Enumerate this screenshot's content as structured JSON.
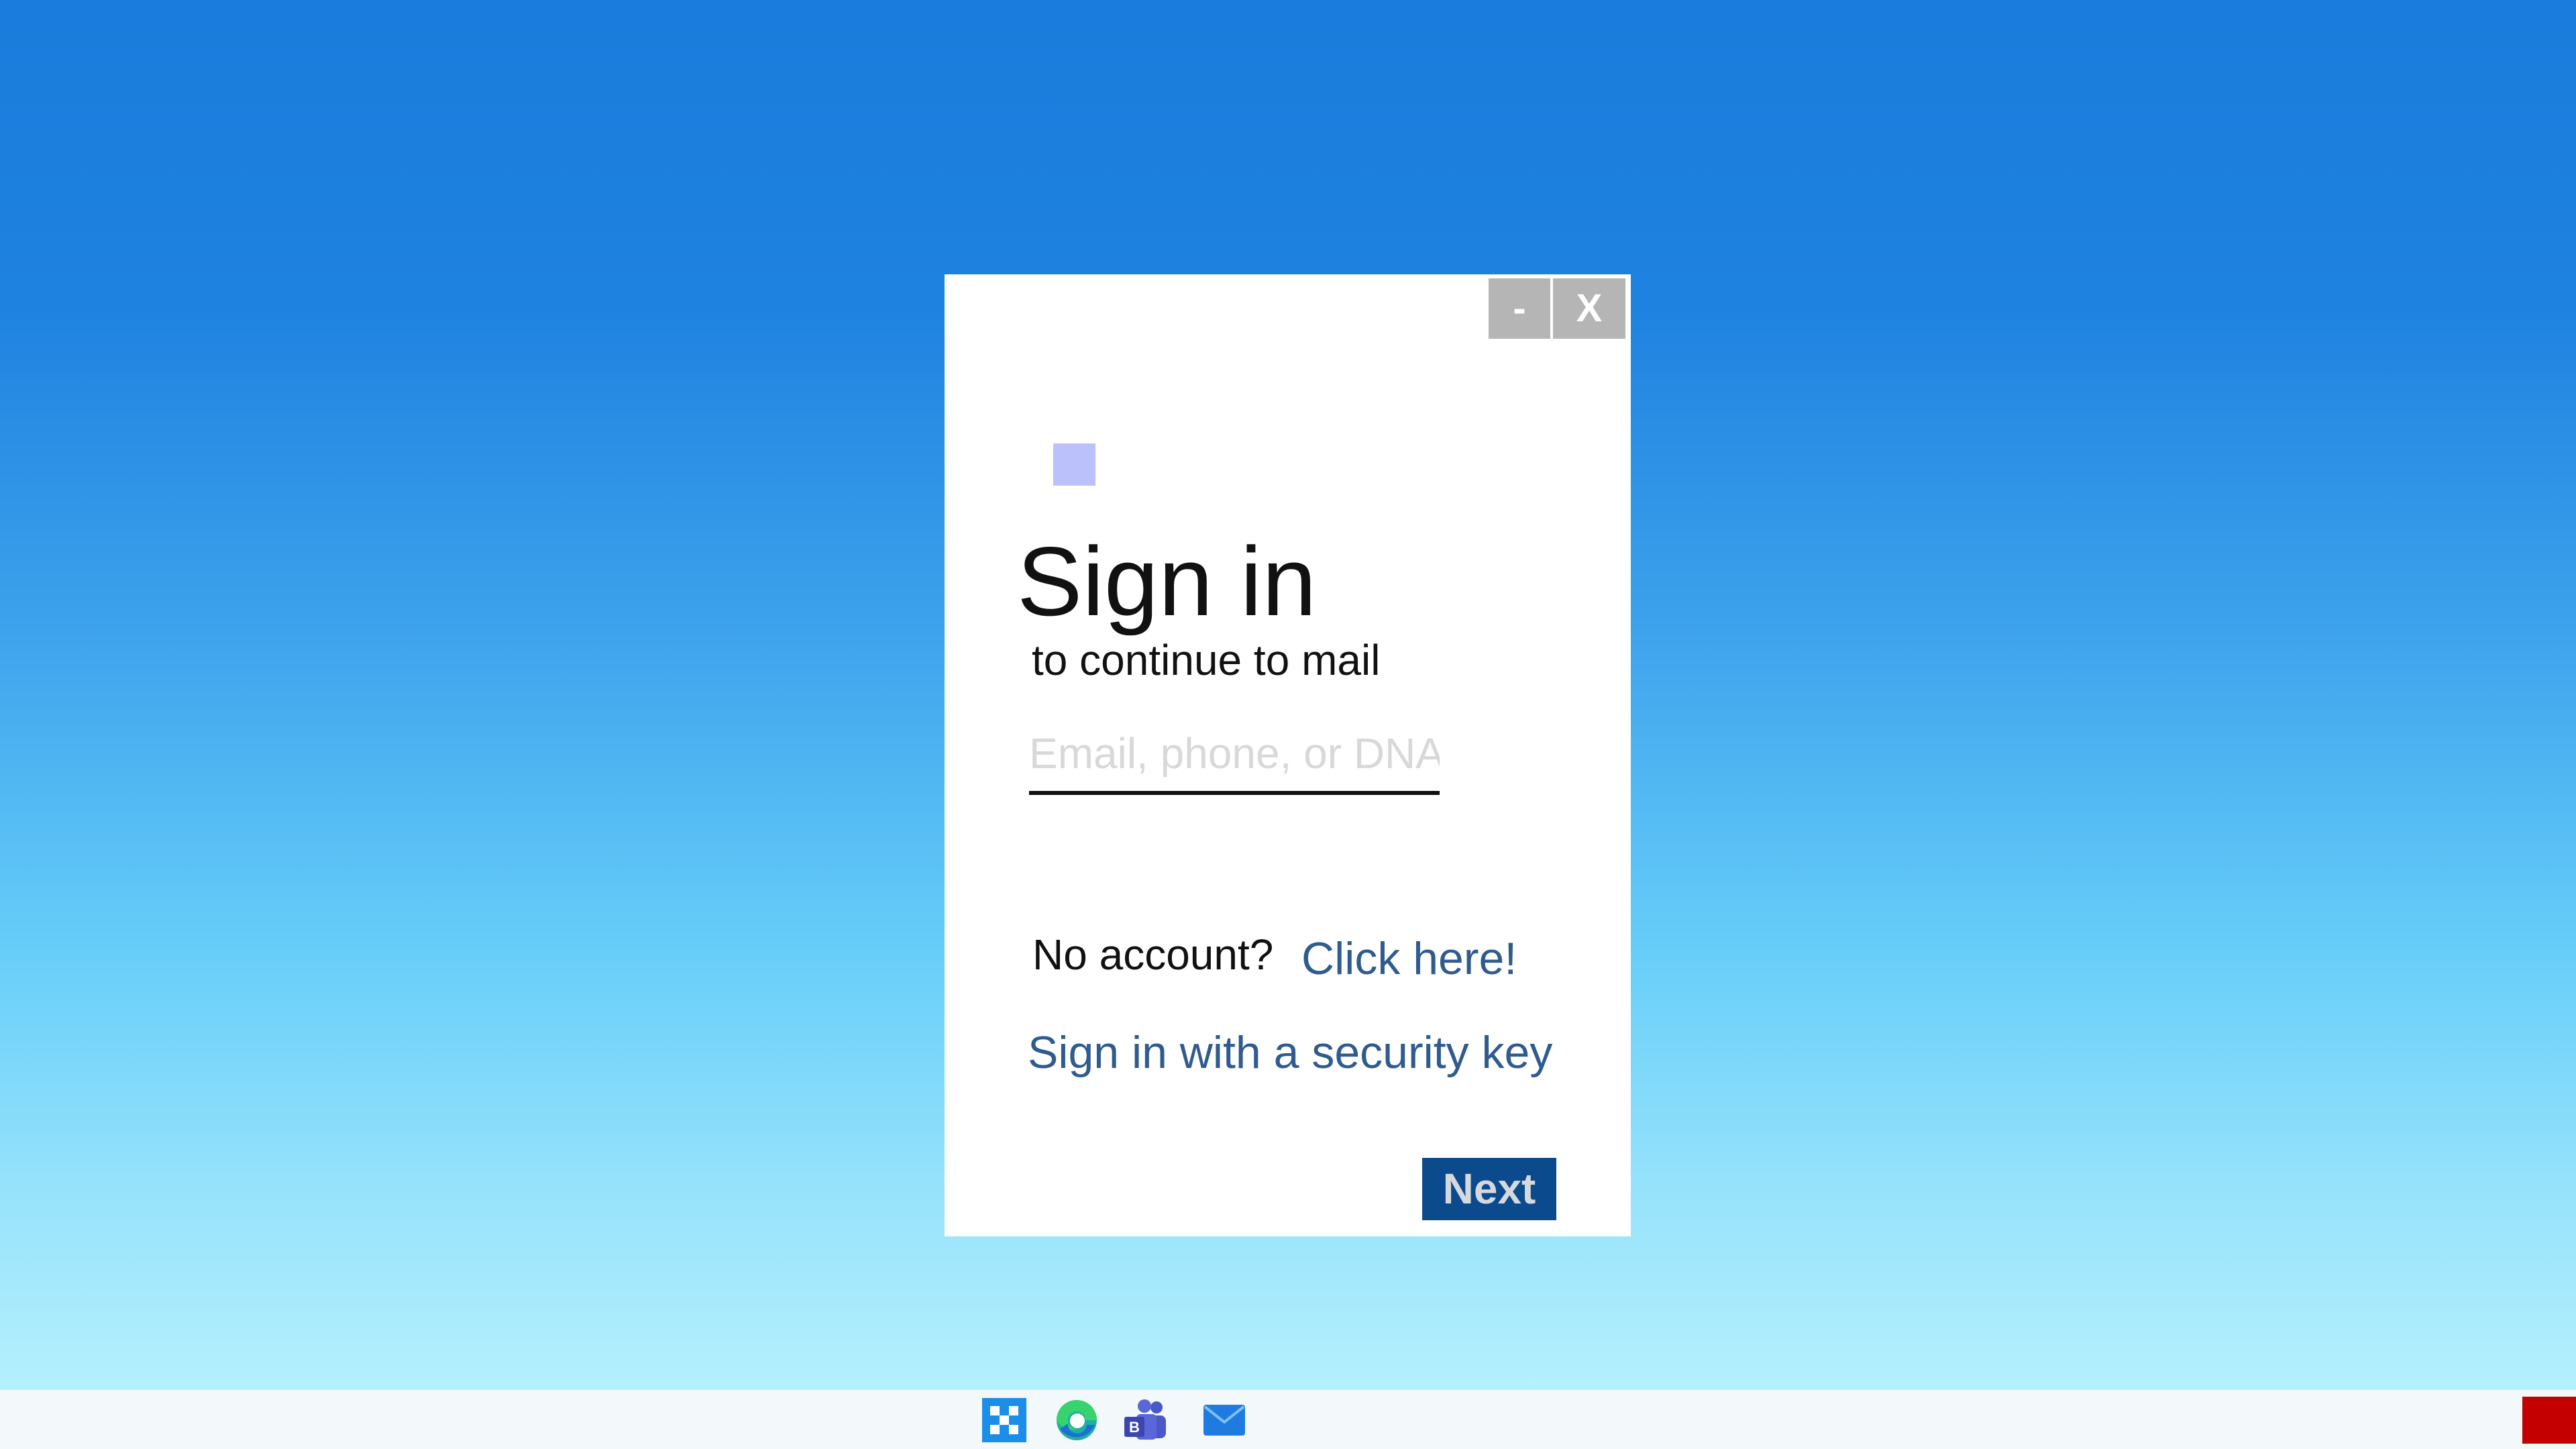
{
  "colors": {
    "desktop_top": "#1a7cdc",
    "desktop_bottom": "#b5f0fd",
    "link": "#2f5b8e",
    "next_button_bg": "#0b4a8c",
    "window_button_bg": "#b5b5b5",
    "logo": "#bbc1fb",
    "taskbar_bg": "#f3f8fa",
    "corner_button": "#c40000"
  },
  "dialog": {
    "minimize_label": "-",
    "close_label": "X",
    "title": "Sign in",
    "subtitle": "to continue to mail",
    "email_placeholder": "Email, phone, or DNA",
    "email_value": "",
    "no_account_label": "No account?",
    "signup_link": "Click here!",
    "security_key_link": "Sign in with a security key",
    "next_label": "Next"
  },
  "taskbar": {
    "icons": [
      "start-icon",
      "edge-browser-icon",
      "teams-icon",
      "mail-icon"
    ],
    "corner_icon": "show-desktop-button"
  }
}
